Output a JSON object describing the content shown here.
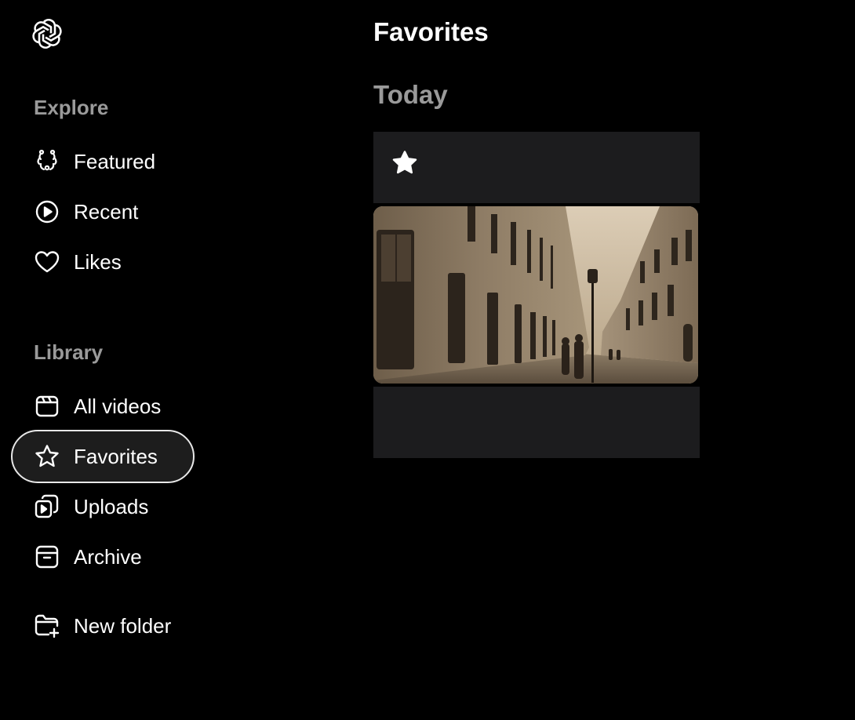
{
  "sidebar": {
    "explore_label": "Explore",
    "library_label": "Library",
    "explore_items": [
      {
        "label": "Featured",
        "icon": "laurel-icon"
      },
      {
        "label": "Recent",
        "icon": "play-circle-icon"
      },
      {
        "label": "Likes",
        "icon": "heart-icon"
      }
    ],
    "library_items": [
      {
        "label": "All videos",
        "icon": "clapperboard-icon"
      },
      {
        "label": "Favorites",
        "icon": "star-icon",
        "active": true
      },
      {
        "label": "Uploads",
        "icon": "uploads-icon"
      },
      {
        "label": "Archive",
        "icon": "archive-icon"
      }
    ],
    "new_folder_label": "New folder",
    "new_folder_icon": "folder-plus-icon"
  },
  "main": {
    "title": "Favorites",
    "groups": [
      {
        "title": "Today"
      }
    ]
  },
  "colors": {
    "background": "#000000",
    "card": "#1c1c1e",
    "muted_text": "#9a9a9a",
    "active_outline": "#e8e8e8"
  }
}
